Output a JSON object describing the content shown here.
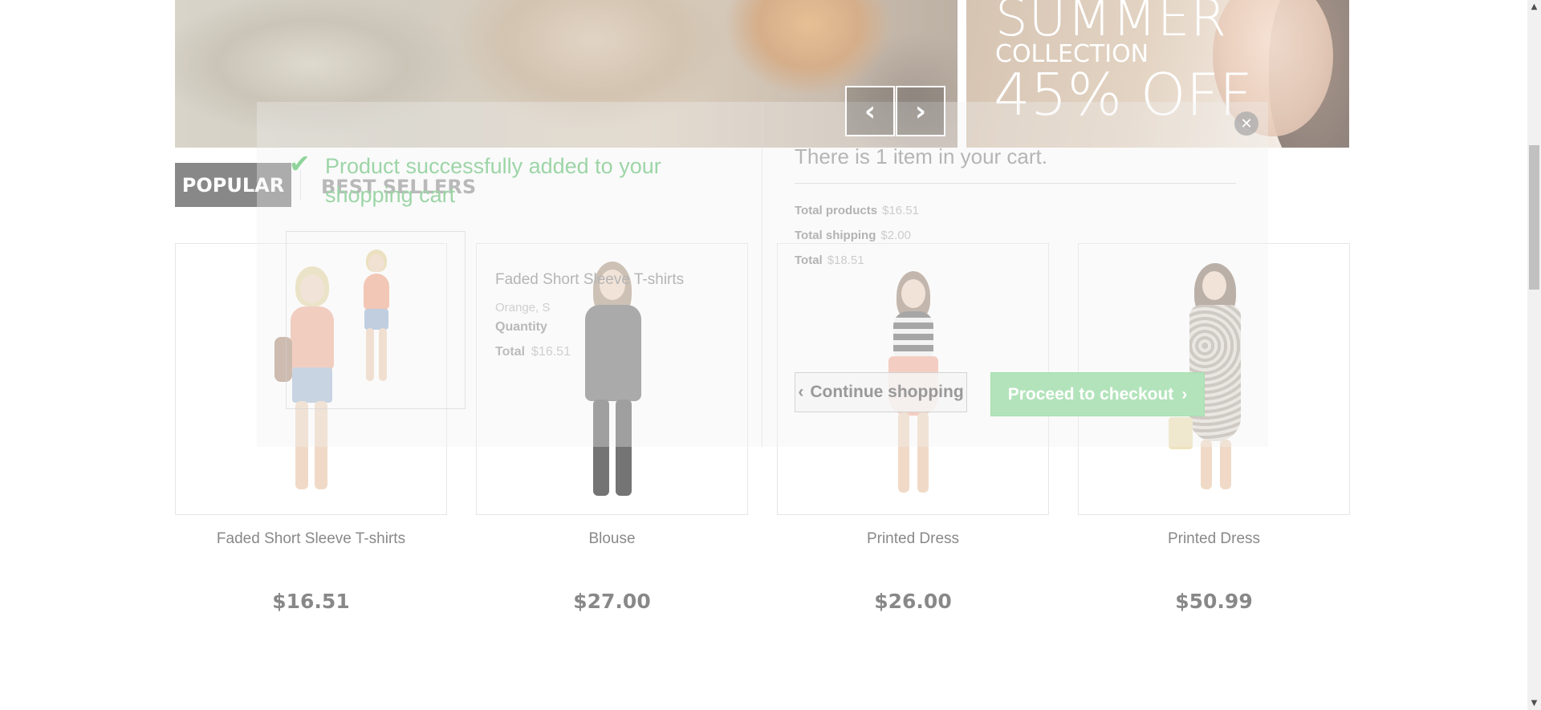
{
  "banner": {
    "promo_title": "SUMMER",
    "promo_subtitle": "COLLECTION",
    "promo_discount": "45% OFF"
  },
  "tabs": {
    "popular": "POPULAR",
    "best_sellers": "BEST SELLERS"
  },
  "products": [
    {
      "name": "Faded Short Sleeve T-shirts",
      "price": "$16.51"
    },
    {
      "name": "Blouse",
      "price": "$27.00"
    },
    {
      "name": "Printed Dress",
      "price": "$26.00"
    },
    {
      "name": "Printed Dress",
      "price": "$50.99"
    }
  ],
  "modal": {
    "success_message": "Product successfully added to your shopping cart",
    "product_name": "Faded Short Sleeve T-shirts",
    "attributes": "Orange, S",
    "quantity_label": "Quantity",
    "total_label": "Total",
    "total_value": "$16.51",
    "cart_count_text": "There is 1 item in your cart.",
    "total_products_label": "Total products",
    "total_products_value": "$16.51",
    "total_shipping_label": "Total shipping",
    "total_shipping_value": "$2.00",
    "cart_total_label": "Total",
    "cart_total_value": "$18.51",
    "continue_label": "Continue shopping",
    "checkout_label": "Proceed to checkout"
  },
  "icons": {
    "check": "check-icon",
    "close": "close-icon",
    "prev": "chevron-left-icon",
    "next": "chevron-right-icon"
  },
  "colors": {
    "success_green": "#9dd5a7",
    "checkout_button": "#b3e3bb",
    "tab_active_bg": "#333333"
  }
}
